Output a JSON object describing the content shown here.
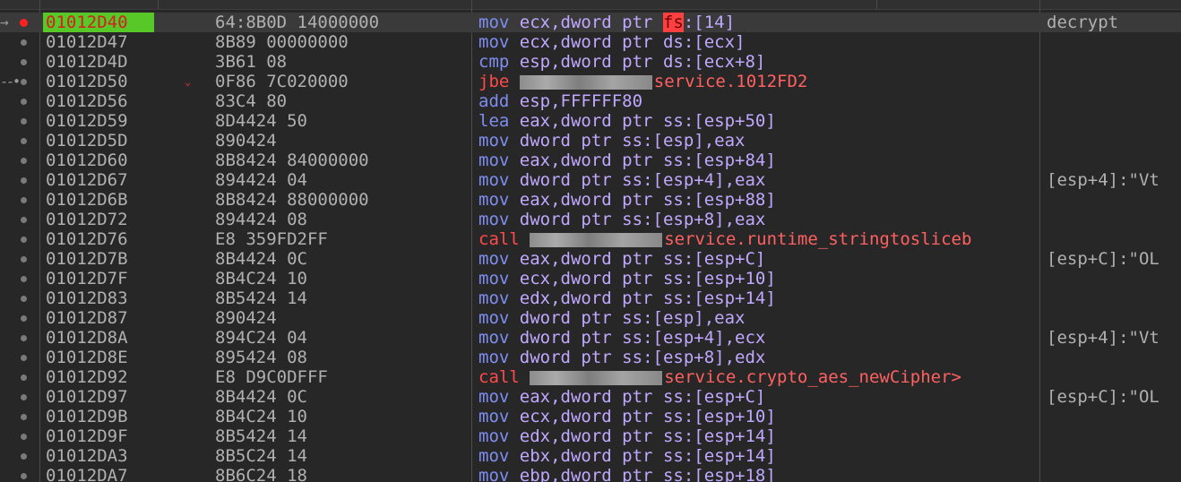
{
  "eip_arrow": "→",
  "jump_arrow": "--•",
  "jump_chevron": "⌄",
  "rows": [
    {
      "addr": "01012D40",
      "bytes": "64:8B0D 14000000",
      "mn": "mov",
      "op": "ecx,dword ptr ",
      "seg": "fs",
      "rest": ":[14]",
      "comment": "decrypt"
    },
    {
      "addr": "01012D47",
      "bytes": "8B89 00000000",
      "mn": "mov",
      "op": "ecx,dword ptr ",
      "seg": "ds",
      "rest": ":[ecx]",
      "comment": ""
    },
    {
      "addr": "01012D4D",
      "bytes": "3B61 08",
      "mn": "cmp",
      "op": "esp,dword ptr ",
      "seg": "ds",
      "rest": ":[ecx+8]",
      "comment": ""
    },
    {
      "addr": "01012D50",
      "bytes": "0F86 7C020000",
      "mn": "jbe",
      "op": "service.1012FD2",
      "seg": "",
      "rest": "",
      "comment": ""
    },
    {
      "addr": "01012D56",
      "bytes": "83C4 80",
      "mn": "add",
      "op": "esp,FFFFFF80",
      "seg": "",
      "rest": "",
      "comment": ""
    },
    {
      "addr": "01012D59",
      "bytes": "8D4424 50",
      "mn": "lea",
      "op": "eax,dword ptr ",
      "seg": "ss",
      "rest": ":[esp+50]",
      "comment": ""
    },
    {
      "addr": "01012D5D",
      "bytes": "890424",
      "mn": "mov",
      "op": "dword ptr ",
      "seg": "ss",
      "rest": ":[esp],eax",
      "comment": ""
    },
    {
      "addr": "01012D60",
      "bytes": "8B8424 84000000",
      "mn": "mov",
      "op": "eax,dword ptr ",
      "seg": "ss",
      "rest": ":[esp+84]",
      "comment": ""
    },
    {
      "addr": "01012D67",
      "bytes": "894424 04",
      "mn": "mov",
      "op": "dword ptr ",
      "seg": "ss",
      "rest": ":[esp+4],eax",
      "comment": "[esp+4]:\"Vt"
    },
    {
      "addr": "01012D6B",
      "bytes": "8B8424 88000000",
      "mn": "mov",
      "op": "eax,dword ptr ",
      "seg": "ss",
      "rest": ":[esp+88]",
      "comment": ""
    },
    {
      "addr": "01012D72",
      "bytes": "894424 08",
      "mn": "mov",
      "op": "dword ptr ",
      "seg": "ss",
      "rest": ":[esp+8],eax",
      "comment": ""
    },
    {
      "addr": "01012D76",
      "bytes": "E8 359FD2FF",
      "mn": "call",
      "op": "service.runtime_stringtosliceb",
      "seg": "",
      "rest": "",
      "comment": ""
    },
    {
      "addr": "01012D7B",
      "bytes": "8B4424 0C",
      "mn": "mov",
      "op": "eax,dword ptr ",
      "seg": "ss",
      "rest": ":[esp+C]",
      "comment": "[esp+C]:\"OL"
    },
    {
      "addr": "01012D7F",
      "bytes": "8B4C24 10",
      "mn": "mov",
      "op": "ecx,dword ptr ",
      "seg": "ss",
      "rest": ":[esp+10]",
      "comment": ""
    },
    {
      "addr": "01012D83",
      "bytes": "8B5424 14",
      "mn": "mov",
      "op": "edx,dword ptr ",
      "seg": "ss",
      "rest": ":[esp+14]",
      "comment": ""
    },
    {
      "addr": "01012D87",
      "bytes": "890424",
      "mn": "mov",
      "op": "dword ptr ",
      "seg": "ss",
      "rest": ":[esp],eax",
      "comment": ""
    },
    {
      "addr": "01012D8A",
      "bytes": "894C24 04",
      "mn": "mov",
      "op": "dword ptr ",
      "seg": "ss",
      "rest": ":[esp+4],ecx",
      "comment": "[esp+4]:\"Vt"
    },
    {
      "addr": "01012D8E",
      "bytes": "895424 08",
      "mn": "mov",
      "op": "dword ptr ",
      "seg": "ss",
      "rest": ":[esp+8],edx",
      "comment": ""
    },
    {
      "addr": "01012D92",
      "bytes": "E8 D9C0DFFF",
      "mn": "call",
      "op": "service.crypto_aes_newCipher>",
      "seg": "",
      "rest": "",
      "comment": ""
    },
    {
      "addr": "01012D97",
      "bytes": "8B4424 0C",
      "mn": "mov",
      "op": "eax,dword ptr ",
      "seg": "ss",
      "rest": ":[esp+C]",
      "comment": "[esp+C]:\"OL"
    },
    {
      "addr": "01012D9B",
      "bytes": "8B4C24 10",
      "mn": "mov",
      "op": "ecx,dword ptr ",
      "seg": "ss",
      "rest": ":[esp+10]",
      "comment": ""
    },
    {
      "addr": "01012D9F",
      "bytes": "8B5424 14",
      "mn": "mov",
      "op": "edx,dword ptr ",
      "seg": "ss",
      "rest": ":[esp+14]",
      "comment": ""
    },
    {
      "addr": "01012DA3",
      "bytes": "8B5C24 14",
      "mn": "mov",
      "op": "ebx,dword ptr ",
      "seg": "ss",
      "rest": ":[esp+14]",
      "comment": ""
    },
    {
      "addr": "01012DA7",
      "bytes": "8B6C24 18",
      "mn": "mov",
      "op": "ebp,dword ptr ",
      "seg": "ss",
      "rest": ":[esp+18]",
      "comment": ""
    }
  ]
}
